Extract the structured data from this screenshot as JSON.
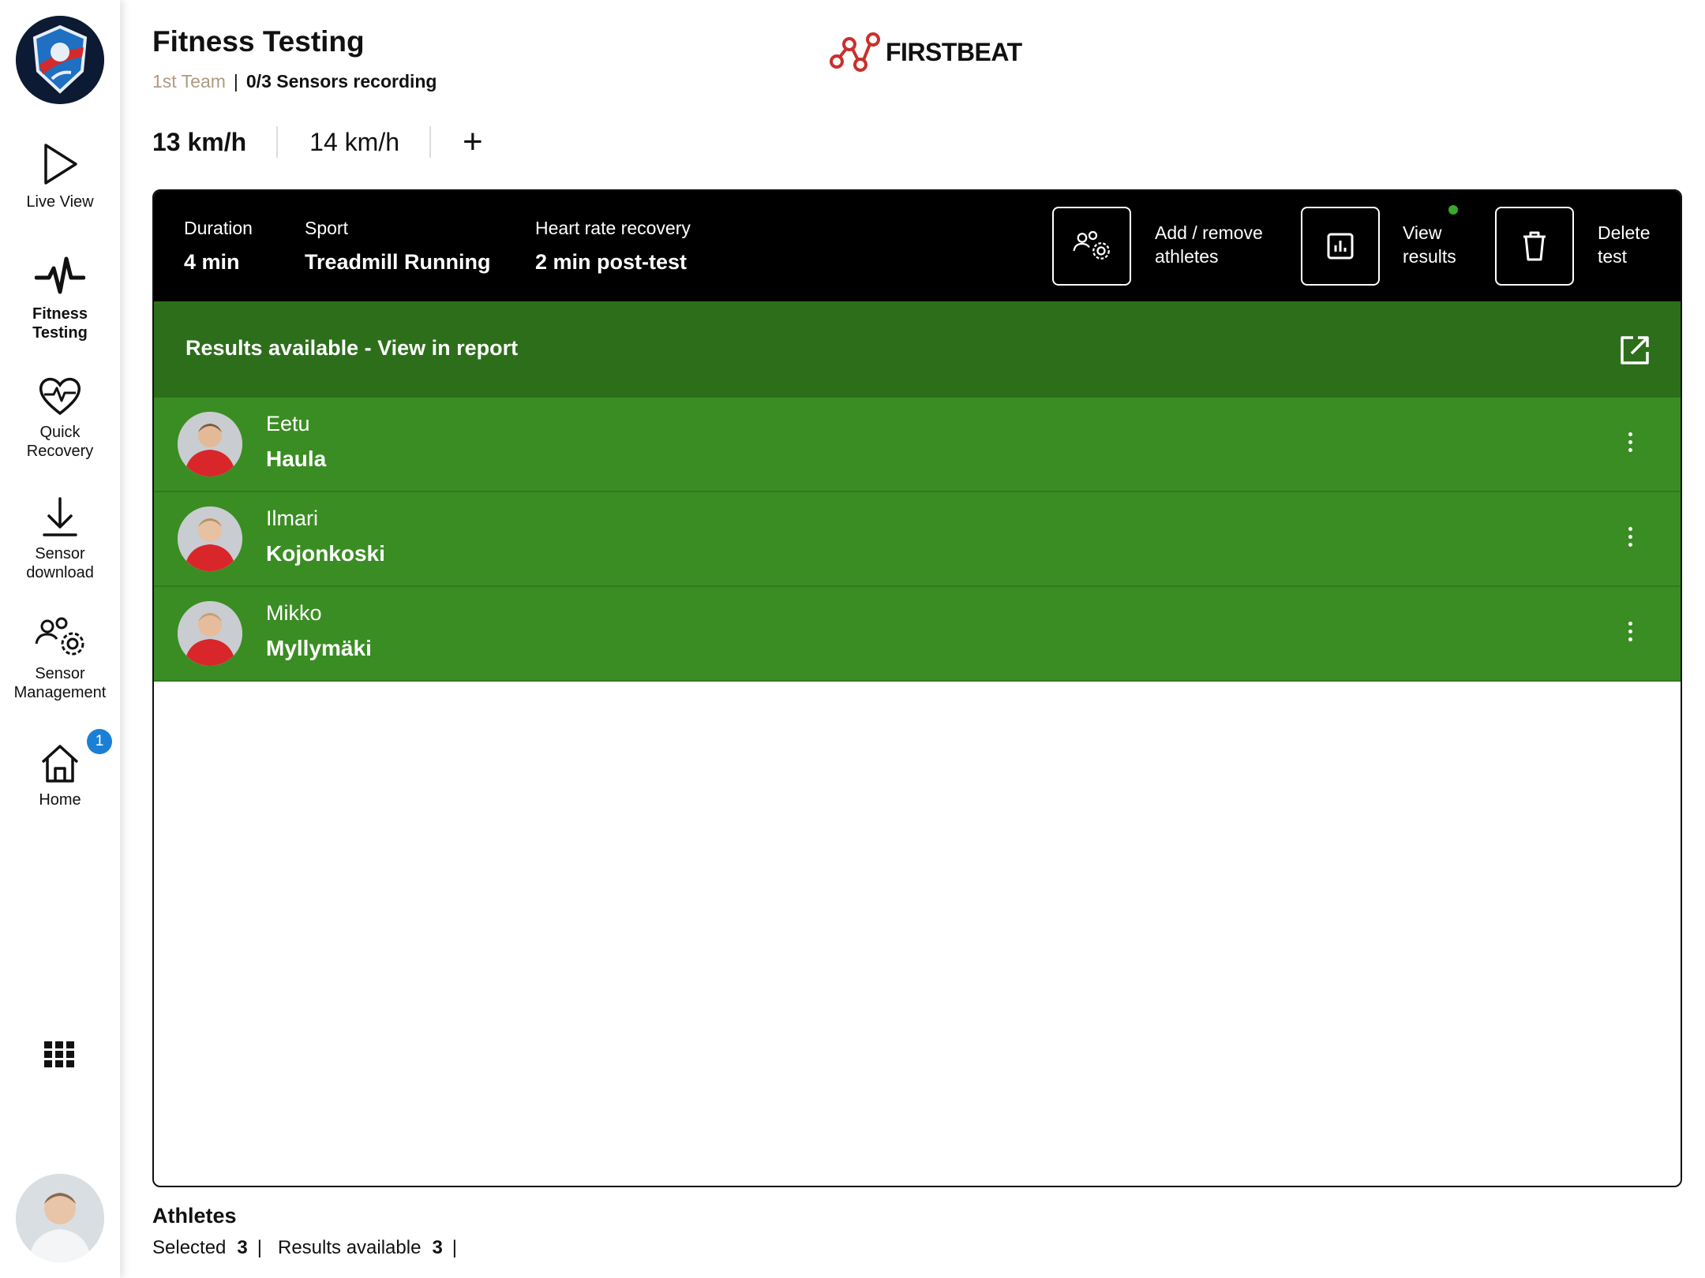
{
  "sidebar": {
    "team_logo": "team-logo",
    "items": [
      {
        "label": "Live View",
        "icon": "play-icon"
      },
      {
        "label": "Fitness\nTesting",
        "icon": "heartbeat-pulse-icon"
      },
      {
        "label": "Quick\nRecovery",
        "icon": "heart-pulse-icon"
      },
      {
        "label": "Sensor\ndownload",
        "icon": "download-icon"
      },
      {
        "label": "Sensor\nManagement",
        "icon": "users-gear-icon"
      },
      {
        "label": "Home",
        "icon": "home-icon"
      }
    ],
    "home_badge": "1",
    "apps_icon": "grid-icon"
  },
  "header": {
    "title": "Fitness Testing",
    "team": "1st Team",
    "separator": "|",
    "sensors": "0/3 Sensors recording",
    "brand": "FIRSTBEAT"
  },
  "speed_tabs": [
    {
      "label": "13 km/h",
      "active": true
    },
    {
      "label": "14 km/h",
      "active": false
    }
  ],
  "add_tab": "+",
  "test": {
    "duration_label": "Duration",
    "duration_value": "4 min",
    "sport_label": "Sport",
    "sport_value": "Treadmill Running",
    "hr_label": "Heart rate recovery",
    "hr_value": "2 min post-test",
    "actions": {
      "add_remove": "Add / remove\nathletes",
      "view_results": "View\nresults",
      "delete": "Delete\ntest"
    }
  },
  "results_banner": "Results available - View in report",
  "athletes": [
    {
      "first": "Eetu",
      "last": "Haula"
    },
    {
      "first": "Ilmari",
      "last": "Kojonkoski"
    },
    {
      "first": "Mikko",
      "last": "Myllymäki"
    }
  ],
  "footer": {
    "title": "Athletes",
    "selected_label": "Selected",
    "selected_value": "3",
    "results_label": "Results available",
    "results_value": "3",
    "pipe": "|"
  },
  "colors": {
    "results_dark_green": "#2d6e1b",
    "athlete_green": "#3a8d23",
    "badge_blue": "#1b7fd6",
    "brand_red": "#c9302c",
    "team_tan": "#b09a82"
  }
}
